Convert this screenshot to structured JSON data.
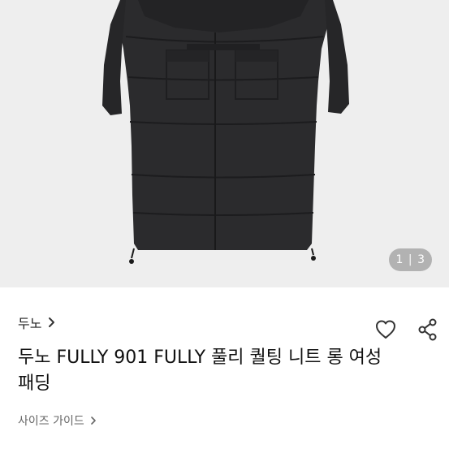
{
  "gallery": {
    "current_page": "1",
    "separator": "|",
    "total_pages": "3"
  },
  "product": {
    "brand": "두노",
    "title": "두노 FULLY 901 FULLY 풀리 퀄팅 니트 롱 여성 패딩"
  },
  "links": {
    "size_guide": "사이즈 가이드"
  },
  "icons": {
    "brand_chevron": "chevron-right-icon",
    "wishlist": "heart-outline-icon",
    "share": "share-icon",
    "size_guide_chevron": "chevron-right-icon"
  },
  "colors": {
    "gallery_background": "#eeeeee",
    "coat": "#2b2b2d",
    "text_primary": "#222222",
    "text_secondary": "#666666"
  }
}
